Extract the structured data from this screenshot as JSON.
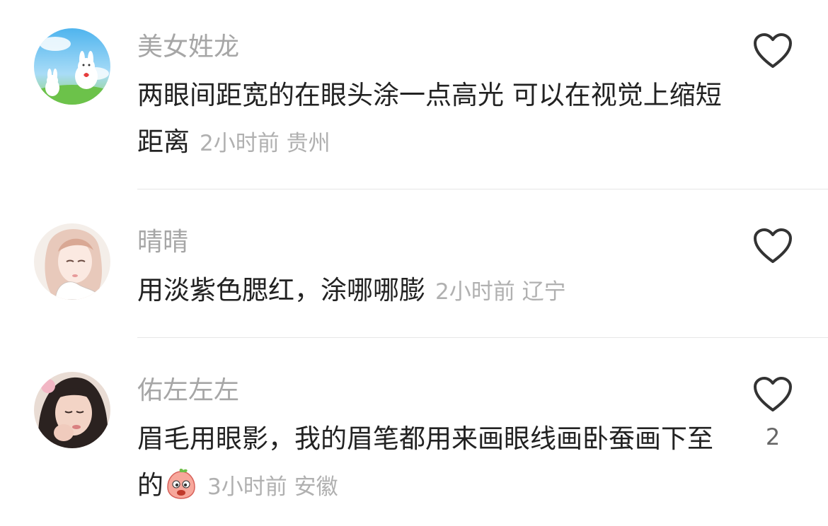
{
  "comments": [
    {
      "username": "美女姓龙",
      "text": "两眼间距宽的在眼头涂一点高光 可以在视觉上缩短距离",
      "time": "2小时前",
      "location": "贵州",
      "like_count": "",
      "avatar": "bunny-avatar"
    },
    {
      "username": "晴晴",
      "text": "用淡紫色腮红，涂哪哪膨",
      "time": "2小时前",
      "location": "辽宁",
      "like_count": "",
      "avatar": "illustrated-girl-avatar"
    },
    {
      "username": "佑左左左",
      "text": "眉毛用眼影，我的眉笔都用来画眼线画卧蚕画下至的",
      "time": "3小时前",
      "location": "安徽",
      "like_count": "2",
      "avatar": "girl-photo-avatar",
      "emoji": "peach-face-emoji"
    }
  ],
  "colors": {
    "username": "#a6a6a6",
    "text": "#222222",
    "meta": "#b0b0b0",
    "divider": "#e6e6e6",
    "heart_outline": "#333333"
  }
}
